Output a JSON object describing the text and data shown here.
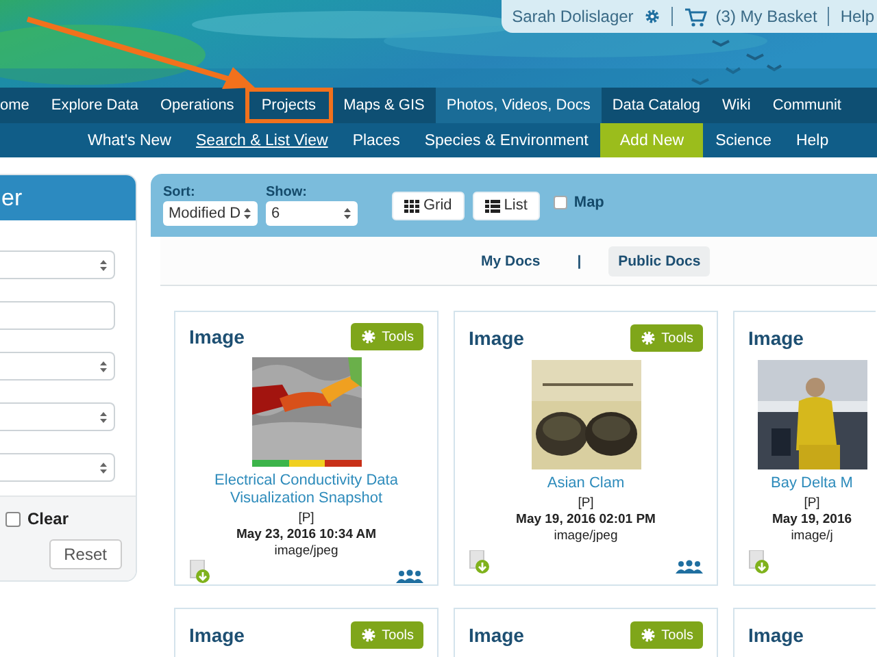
{
  "user_bar": {
    "user": "Sarah Dolislager",
    "basket": "(3) My Basket",
    "help": "Help"
  },
  "main_nav": [
    {
      "label": "ome",
      "selected": false,
      "highlighted": false
    },
    {
      "label": "Explore Data",
      "selected": false,
      "highlighted": false
    },
    {
      "label": "Operations",
      "selected": false,
      "highlighted": false
    },
    {
      "label": "Projects",
      "selected": false,
      "highlighted": true
    },
    {
      "label": "Maps & GIS",
      "selected": false,
      "highlighted": false
    },
    {
      "label": "Photos, Videos, Docs",
      "selected": true,
      "highlighted": false
    },
    {
      "label": "Data Catalog",
      "selected": false,
      "highlighted": false
    },
    {
      "label": "Wiki",
      "selected": false,
      "highlighted": false
    },
    {
      "label": "Communit",
      "selected": false,
      "highlighted": false
    }
  ],
  "sub_nav": [
    {
      "label": "What's New",
      "kind": "link",
      "selected": false
    },
    {
      "label": "Search & List View",
      "kind": "link",
      "selected": true
    },
    {
      "label": "Places",
      "kind": "link",
      "selected": false
    },
    {
      "label": "Species & Environment",
      "kind": "link",
      "selected": false
    },
    {
      "label": "Add New",
      "kind": "accent",
      "selected": false
    },
    {
      "label": "Science",
      "kind": "link",
      "selected": false
    },
    {
      "label": "Help",
      "kind": "link",
      "selected": false
    }
  ],
  "filter": {
    "title": "er",
    "fields": [
      {
        "kind": "select"
      },
      {
        "kind": "input"
      },
      {
        "kind": "select"
      },
      {
        "kind": "select"
      },
      {
        "kind": "select"
      }
    ],
    "clear": {
      "label": "Clear",
      "checked": false
    },
    "reset": "Reset"
  },
  "toolbar": {
    "sort": {
      "label": "Sort:",
      "value": "Modified D"
    },
    "show": {
      "label": "Show:",
      "value": "6"
    },
    "views": [
      {
        "label": "Grid",
        "kind": "grid"
      },
      {
        "label": "List",
        "kind": "list"
      }
    ],
    "map": {
      "label": "Map",
      "checked": false
    }
  },
  "doc_tabs": {
    "tabs": [
      {
        "label": "My Docs",
        "selected": false
      },
      {
        "label": "Public Docs",
        "selected": true
      }
    ],
    "separator": "|"
  },
  "cards": [
    {
      "type": "Image",
      "tools": "Tools",
      "title": "Electrical Conductivity Data Visualization Snapshot",
      "flag": "[P]",
      "date": "May 23, 2016 10:34 AM",
      "mime": "image/jpeg",
      "shared": true,
      "clipped": false
    },
    {
      "type": "Image",
      "tools": "Tools",
      "title": "Asian Clam",
      "flag": "[P]",
      "date": "May 19, 2016 02:01 PM",
      "mime": "image/jpeg",
      "shared": true,
      "clipped": false
    },
    {
      "type": "Image",
      "title": "Bay Delta M",
      "flag": "[P]",
      "date": "May 19, 2016",
      "mime": "image/j",
      "shared": false,
      "clipped": true
    },
    {
      "type": "Image",
      "tools": "Tools",
      "clipped": false
    },
    {
      "type": "Image",
      "tools": "Tools",
      "clipped": false
    },
    {
      "type": "Image",
      "clipped": true
    }
  ]
}
